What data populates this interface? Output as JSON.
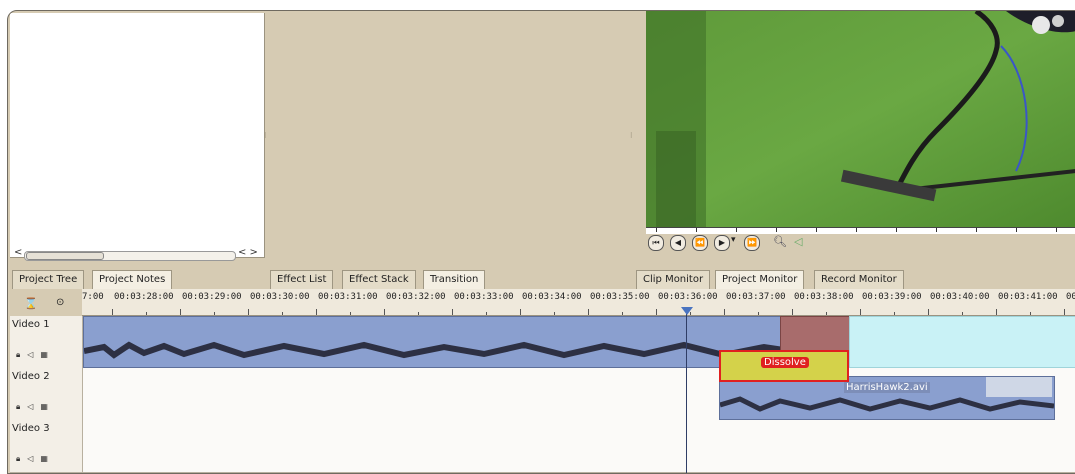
{
  "project_tree": {
    "scroll_right_label": "< >"
  },
  "tabs": {
    "left": [
      "Project Tree",
      "Project Notes"
    ],
    "middle": [
      "Effect List",
      "Effect Stack",
      "Transition"
    ],
    "right": [
      "Clip Monitor",
      "Project Monitor",
      "Record Monitor"
    ]
  },
  "monitor": {
    "controls": [
      "rewind-icon",
      "play-back-icon",
      "step-back-icon",
      "play-icon",
      "dropdown-icon",
      "step-forward-icon",
      "zoom-icon",
      "volume-icon"
    ]
  },
  "timeline": {
    "ruler_labels": [
      "7:00",
      "00:03:28:00",
      "00:03:29:00",
      "00:03:30:00",
      "00:03:31:00",
      "00:03:32:00",
      "00:03:33:00",
      "00:03:34:00",
      "00:03:35:00",
      "00:03:36:00",
      "00:03:37:00",
      "00:03:38:00",
      "00:03:39:00",
      "00:03:40:00",
      "00:03:41:00",
      "00:0"
    ],
    "tracks": [
      {
        "name": "Video 1"
      },
      {
        "name": "Video 2"
      },
      {
        "name": "Video 3"
      }
    ],
    "transition_label": "Dissolve",
    "clip2_label": "HarrisHawk2.avi"
  },
  "colors": {
    "clip_blue": "#8a9fcf",
    "clip_cyan": "#c9f2f6",
    "transition_yellow": "#d4d24a",
    "transition_border": "#e02020"
  }
}
